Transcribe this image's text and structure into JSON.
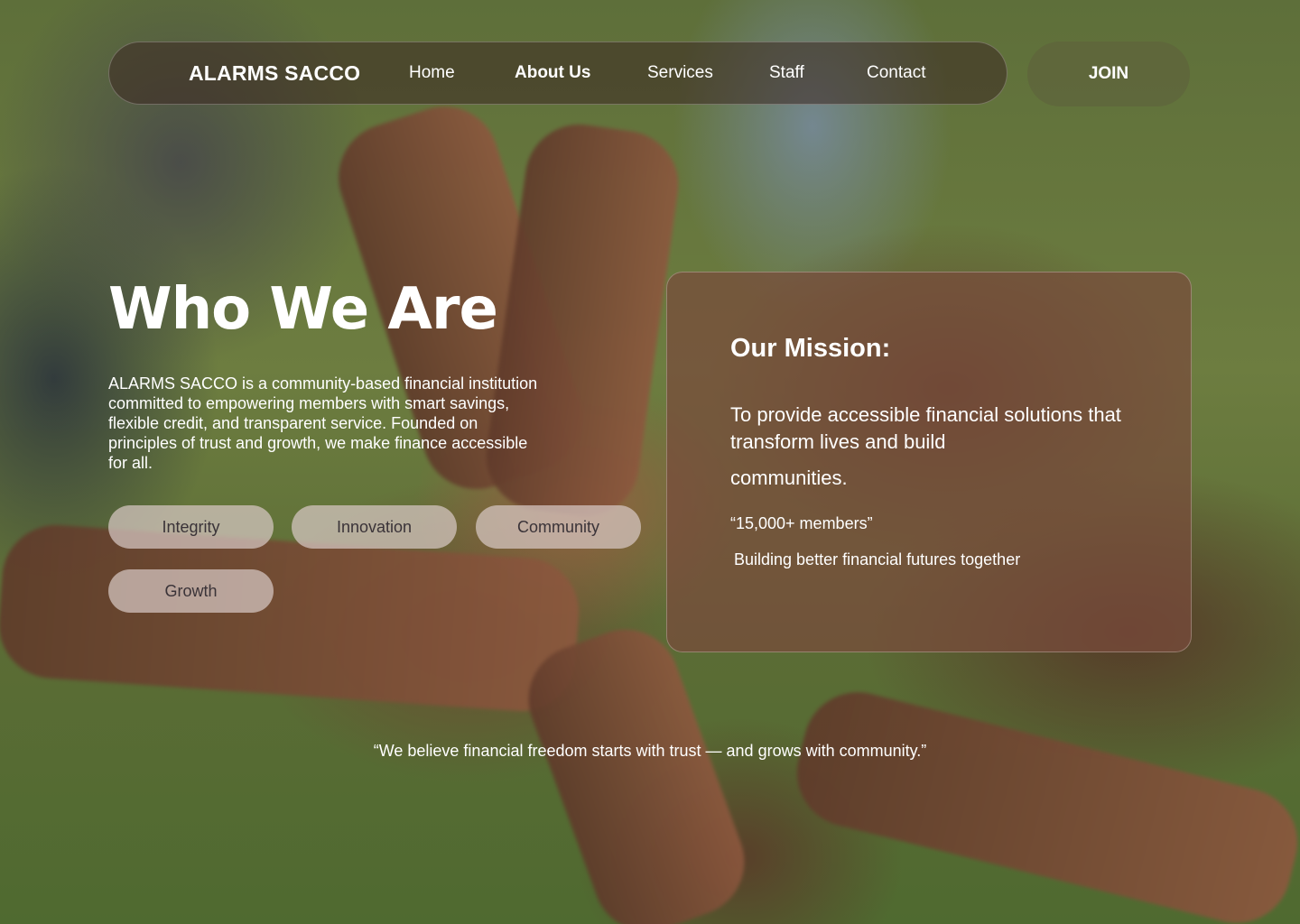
{
  "nav": {
    "brand": "ALARMS SACCO",
    "links": [
      "Home",
      "About Us",
      "Services",
      "Staff",
      "Contact"
    ],
    "active": "About Us",
    "join_label": "JOIN"
  },
  "hero": {
    "title": "Who We Are",
    "intro": "ALARMS SACCO is a community-based financial institution committed to empowering members with smart savings, flexible credit, and transparent service. Founded on principles of trust and growth, we make finance accessible for all.",
    "values": [
      "Integrity",
      "Innovation",
      "Community",
      "Growth"
    ]
  },
  "mission": {
    "title": "Our Mission:",
    "text_main": "To provide accessible financial solutions that transform lives and build",
    "text_last": "communities.",
    "stat": "“15,000+ members”",
    "sub": "Building better financial futures together"
  },
  "quote": "“We believe financial freedom starts with trust — and grows with community.”",
  "colors": {
    "pill_bg": "#d7c8c3",
    "pill_text": "#3a3338",
    "card_bg": "#784b3c",
    "nav_bg": "#3c2823",
    "join_bg": "#5f643c"
  }
}
